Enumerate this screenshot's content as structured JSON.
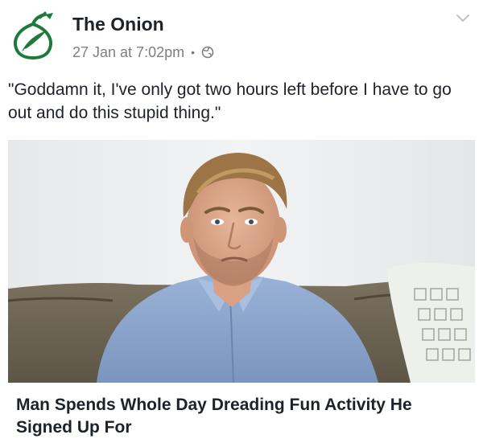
{
  "post": {
    "page_name": "The Onion",
    "timestamp": "27 Jan at 7:02pm",
    "separator": "•",
    "privacy_icon": "globe-icon",
    "menu_icon": "chevron-down-icon",
    "avatar_icon": "onion-logo",
    "text": "\"Goddamn it, I've only got two hours left before I have to go out and do this stupid thing.\""
  },
  "link": {
    "headline": "Man Spends Whole Day Dreading Fun Activity He Signed Up For",
    "image": "photo of a bearded man in a blue shirt sitting on a couch"
  },
  "colors": {
    "brand_green": "#1e7a3a",
    "text_primary": "#1d2129",
    "text_secondary": "#7f7f7f",
    "shirt_blue": "#8fa9cf",
    "wall": "#eceeef",
    "couch": "#6f6756"
  }
}
